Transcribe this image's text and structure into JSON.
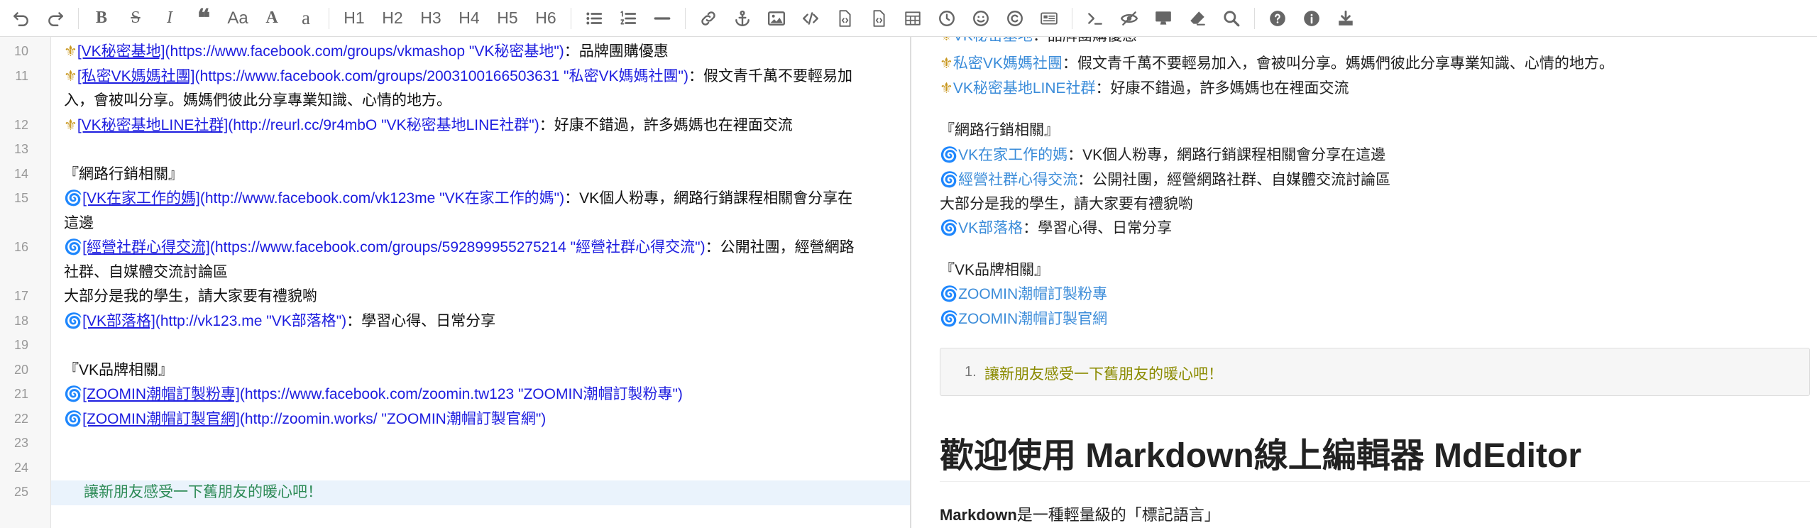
{
  "toolbar": {
    "heading_labels": [
      "H1",
      "H2",
      "H3",
      "H4",
      "H5",
      "H6"
    ],
    "font_size_label": "Aa",
    "big_a": "A",
    "small_a": "a"
  },
  "editor": {
    "lines": [
      {
        "num": "10",
        "icon": "⚜",
        "link_text": "[VK秘密基地]",
        "url": "(https://www.facebook.com/groups/vkmashop \"VK秘密基地\")",
        "desc": "：品牌團購優惠"
      },
      {
        "num": "11",
        "icon": "⚜",
        "link_text": "[私密VK媽媽社團]",
        "url": "(https://www.facebook.com/groups/2003100166503631 \"私密VK媽媽社團\")",
        "desc": "：假文青千萬不要輕易加",
        "cont": "入，會被叫分享。媽媽們彼此分享專業知識、心情的地方。"
      },
      {
        "num": "12",
        "icon": "⚜",
        "link_text": "[VK秘密基地LINE社群]",
        "url": "(http://reurl.cc/9r4mbO \"VK秘密基地LINE社群\")",
        "desc": "：好康不錯過，許多媽媽也在裡面交流"
      },
      {
        "num": "13"
      },
      {
        "num": "14",
        "plain": "『網路行銷相關』"
      },
      {
        "num": "15",
        "icon": "🌀",
        "link_text": "[VK在家工作的媽]",
        "url": "(http://www.facebook.com/vk123me \"VK在家工作的媽\")",
        "desc": "：VK個人粉專，網路行銷課程相關會分享在",
        "cont": "這邊"
      },
      {
        "num": "16",
        "icon": "🌀",
        "link_text": "[經營社群心得交流]",
        "url": "(https://www.facebook.com/groups/592899955275214 \"經營社群心得交流\")",
        "desc": "：公開社團，經營網路",
        "cont": "社群、自媒體交流討論區"
      },
      {
        "num": "17",
        "plain": "大部分是我的學生，請大家要有禮貌喲"
      },
      {
        "num": "18",
        "icon": "🌀",
        "link_text": "[VK部落格]",
        "url": "(http://vk123.me \"VK部落格\")",
        "desc": "：學習心得、日常分享"
      },
      {
        "num": "19"
      },
      {
        "num": "20",
        "plain": "『VK品牌相關』"
      },
      {
        "num": "21",
        "icon": "🌀",
        "link_text": "[ZOOMIN潮帽訂製粉專]",
        "url": "(https://www.facebook.com/zoomin.tw123 \"ZOOMIN潮帽訂製粉專\")",
        "desc": ""
      },
      {
        "num": "22",
        "icon": "🌀",
        "link_text": "[ZOOMIN潮帽訂製官網]",
        "url": "(http://zoomin.works/ \"ZOOMIN潮帽訂製官網\")",
        "desc": ""
      },
      {
        "num": "23"
      },
      {
        "num": "24"
      },
      {
        "num": "25",
        "active_text": "讓新朋友感受一下舊朋友的暖心吧！"
      }
    ]
  },
  "preview": {
    "cut_line": {
      "icon": "⚜",
      "link": "VK秘密基地",
      "desc": "：品牌團購優惠"
    },
    "line_private": {
      "icon": "⚜",
      "link": "私密VK媽媽社團",
      "desc": "：假文青千萬不要輕易加入，會被叫分享。媽媽們彼此分享專業知識、心情的地方。"
    },
    "line_line": {
      "icon": "⚜",
      "link": "VK秘密基地LINE社群",
      "desc": "：好康不錯過，許多媽媽也在裡面交流"
    },
    "section_marketing": "『網路行銷相關』",
    "line_home": {
      "icon": "🌀",
      "link": "VK在家工作的媽",
      "desc": "：VK個人粉專，網路行銷課程相關會分享在這邊"
    },
    "line_community": {
      "icon": "🌀",
      "link": "經營社群心得交流",
      "desc": "：公開社團，經營網路社群、自媒體交流討論區"
    },
    "students": "大部分是我的學生，請大家要有禮貌喲",
    "line_blog": {
      "icon": "🌀",
      "link": "VK部落格",
      "desc": "：學習心得、日常分享"
    },
    "section_brand": "『VK品牌相關』",
    "line_fans": {
      "icon": "🌀",
      "link": "ZOOMIN潮帽訂製粉專"
    },
    "line_site": {
      "icon": "🌀",
      "link": "ZOOMIN潮帽訂製官網"
    },
    "quote_num": "1.",
    "quote_text": "讓新朋友感受一下舊朋友的暖心吧！",
    "heading_pre": "歡迎使用 ",
    "heading_bold": "Markdown",
    "heading_post": "線上編輯器 MdEditor",
    "para_bold": "Markdown",
    "para_rest": "是一種輕量級的「標記語言」"
  }
}
